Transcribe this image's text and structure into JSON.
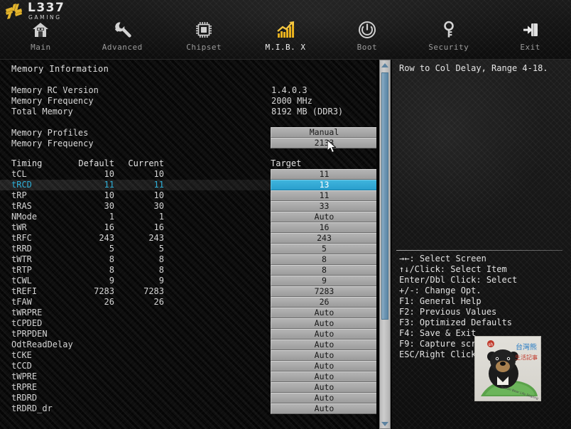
{
  "brand": {
    "logo_main": "L337",
    "logo_sub": "GAMING",
    "logo_icon": "pinwheel-bars-logo",
    "accent_gold": "#E6B325",
    "accent_cyan": "#2FB0D8"
  },
  "nav": {
    "tabs": [
      {
        "label": "Main",
        "icon": "home-icon",
        "active": false
      },
      {
        "label": "Advanced",
        "icon": "wrench-icon",
        "active": false
      },
      {
        "label": "Chipset",
        "icon": "chip-icon",
        "active": false
      },
      {
        "label": "M.I.B. X",
        "icon": "chart-up-icon",
        "active": true
      },
      {
        "label": "Boot",
        "icon": "power-icon",
        "active": false
      },
      {
        "label": "Security",
        "icon": "key-icon",
        "active": false
      },
      {
        "label": "Exit",
        "icon": "exit-icon",
        "active": false
      }
    ]
  },
  "main": {
    "section_title": "Memory Information",
    "info": [
      {
        "key": "Memory RC Version",
        "value": "1.4.0.3"
      },
      {
        "key": "Memory Frequency",
        "value": "2000 MHz"
      },
      {
        "key": "Total Memory",
        "value": "8192 MB (DDR3)"
      }
    ],
    "options": [
      {
        "key": "Memory Profiles",
        "value": "Manual"
      },
      {
        "key": "Memory Frequency",
        "value": "2133"
      }
    ],
    "table": {
      "headers": {
        "timing": "Timing",
        "default": "Default",
        "current": "Current",
        "target": "Target"
      },
      "rows": [
        {
          "name": "tCL",
          "default": "10",
          "current": "10",
          "target": "11",
          "selected": false
        },
        {
          "name": "tRCD",
          "default": "11",
          "current": "11",
          "target": "13",
          "selected": true
        },
        {
          "name": "tRP",
          "default": "10",
          "current": "10",
          "target": "11",
          "selected": false
        },
        {
          "name": "tRAS",
          "default": "30",
          "current": "30",
          "target": "33",
          "selected": false
        },
        {
          "name": "NMode",
          "default": "1",
          "current": "1",
          "target": "Auto",
          "selected": false
        },
        {
          "name": "tWR",
          "default": "16",
          "current": "16",
          "target": "16",
          "selected": false
        },
        {
          "name": "tRFC",
          "default": "243",
          "current": "243",
          "target": "243",
          "selected": false
        },
        {
          "name": "tRRD",
          "default": "5",
          "current": "5",
          "target": "5",
          "selected": false
        },
        {
          "name": "tWTR",
          "default": "8",
          "current": "8",
          "target": "8",
          "selected": false
        },
        {
          "name": "tRTP",
          "default": "8",
          "current": "8",
          "target": "8",
          "selected": false
        },
        {
          "name": "tCWL",
          "default": "9",
          "current": "9",
          "target": "9",
          "selected": false
        },
        {
          "name": "tREFI",
          "default": "7283",
          "current": "7283",
          "target": "7283",
          "selected": false
        },
        {
          "name": "tFAW",
          "default": "26",
          "current": "26",
          "target": "26",
          "selected": false
        },
        {
          "name": "tWRPRE",
          "default": "",
          "current": "",
          "target": "Auto",
          "selected": false
        },
        {
          "name": "tCPDED",
          "default": "",
          "current": "",
          "target": "Auto",
          "selected": false
        },
        {
          "name": "tPRPDEN",
          "default": "",
          "current": "",
          "target": "Auto",
          "selected": false
        },
        {
          "name": "OdtReadDelay",
          "default": "",
          "current": "",
          "target": "Auto",
          "selected": false
        },
        {
          "name": "tCKE",
          "default": "",
          "current": "",
          "target": "Auto",
          "selected": false
        },
        {
          "name": "tCCD",
          "default": "",
          "current": "",
          "target": "Auto",
          "selected": false
        },
        {
          "name": "tWPRE",
          "default": "",
          "current": "",
          "target": "Auto",
          "selected": false
        },
        {
          "name": "tRPRE",
          "default": "",
          "current": "",
          "target": "Auto",
          "selected": false
        },
        {
          "name": "tRDRD",
          "default": "",
          "current": "",
          "target": "Auto",
          "selected": false
        },
        {
          "name": "tRDRD_dr",
          "default": "",
          "current": "",
          "target": "Auto",
          "selected": false
        }
      ]
    }
  },
  "help": {
    "description": "Row to Col Delay, Range 4-18.",
    "keys": [
      "→←: Select Screen",
      "↑↓/Click: Select Item",
      "Enter/Dbl Click: Select",
      "+/-: Change Opt.",
      "F1: General Help",
      "F2: Previous Values",
      "F3: Optimized Defaults",
      "F4: Save & Exit",
      "F9: Capture screen",
      "ESC/Right Click: Exit"
    ],
    "watermark_icon": "taiwan-black-bear-sticker"
  },
  "scrollbar": {
    "up_icon": "scroll-up-arrow-icon",
    "down_icon": "scroll-down-arrow-icon"
  },
  "cursor": {
    "icon": "mouse-pointer-icon"
  }
}
